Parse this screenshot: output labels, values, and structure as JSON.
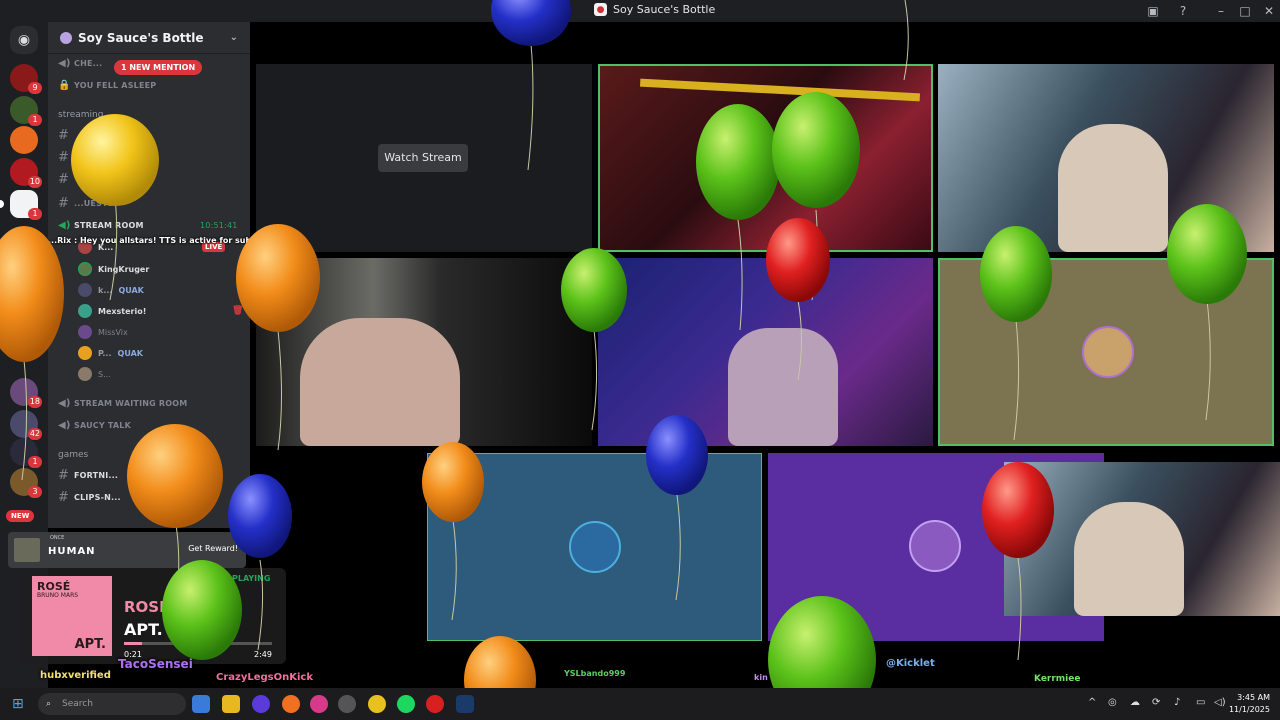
{
  "window": {
    "title": "Soy Sauce's Bottle"
  },
  "server": {
    "name": "Soy Sauce's Bottle",
    "mention_pill": "1 NEW MENTION",
    "top_channels": [
      "CHE...",
      "YOU FELL ASLEEP"
    ],
    "categories": [
      "streaming",
      "games"
    ],
    "text_channels_streaming": [
      "",
      "",
      "",
      "...UESTS"
    ],
    "stream_room": {
      "name": "STREAM ROOM",
      "timer": "10:51:41"
    },
    "voice_users": [
      {
        "name": "K...",
        "status": "LIVE"
      },
      {
        "name": "KingKruger"
      },
      {
        "name": "k...",
        "status": "QUAK"
      },
      {
        "name": "Mexsterio!"
      },
      {
        "name": "MissVix"
      },
      {
        "name": "P...",
        "status": "QUAK"
      },
      {
        "name": "S..."
      }
    ],
    "voice_channels": [
      "STREAM WAITING ROOM",
      "SAUCY TALK"
    ],
    "game_channels": [
      "FORTNI...",
      "CLIPS-N..."
    ],
    "new_label": "NEW"
  },
  "tts_line": "...Rix : Hey you allstars! TTS is active for subs and",
  "promo": {
    "brand": "HUMAN",
    "brand_top": "ONCE",
    "cta": "Get Reward!"
  },
  "music": {
    "album_title": "ROSÉ",
    "album_feature": "BRUNO MARS",
    "album_song": "APT.",
    "artist": "ROSÉ",
    "song": "APT.",
    "elapsed": "0:21",
    "duration": "2:49",
    "progress": 0.124,
    "now_playing": "PLAYING"
  },
  "stage": {
    "watch_button": "Watch Stream"
  },
  "chatters": [
    "TacoSensei",
    "hubxverified",
    "CrazyLegsOnKick",
    "YSLbando999",
    "@Kicklet",
    "Kerrmiee",
    "kin"
  ],
  "taskbar": {
    "search_placeholder": "Search",
    "time": "3:45 AM",
    "date": "11/1/2025"
  },
  "colors": {
    "discord_dark": "#1e1f22",
    "sidebar": "#2b2d31",
    "mention_red": "#da373c",
    "speaking_green": "#4fbf6a",
    "balloon_green": "#5cc21a",
    "balloon_orange": "#f28c1a",
    "balloon_yellow": "#f2c41a",
    "balloon_blue": "#2430c8",
    "balloon_red": "#e02020"
  },
  "icons": [
    "discord-icon",
    "help-icon",
    "inbox-icon",
    "minimize-icon",
    "maximize-icon",
    "close-icon",
    "hash-icon",
    "speaker-icon",
    "lock-icon",
    "windows-start-icon",
    "search-icon"
  ]
}
